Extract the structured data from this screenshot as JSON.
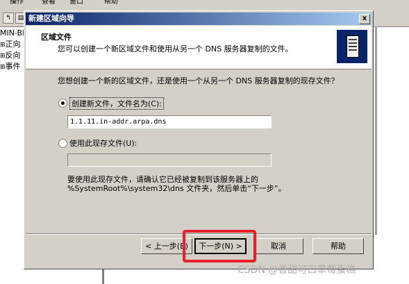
{
  "app": {
    "menu": [
      "操作",
      "查看",
      "窗口",
      "帮助"
    ],
    "tree_items": [
      "MIN-BE",
      "正向",
      "反向",
      "事件"
    ]
  },
  "dialog": {
    "title": "新建区域向导",
    "close_label": "x",
    "header": {
      "title": "区域文件",
      "subtitle": "您可以创建一个新区域文件和使用从另一个 DNS 服务器复制的文件。"
    },
    "question": "您想创建一个新的区域文件，还是使用一个从另一个 DNS 服务器复制的现存文件？",
    "option_new": {
      "label": "创建新文件，文件名为(C):",
      "value": "1.1.11.in-addr.arpa.dns",
      "selected": true
    },
    "option_existing": {
      "label": "使用此现存文件(U):",
      "value": "",
      "selected": false
    },
    "note": "要使用此现存文件，请确认它已经被复制到该服务器上的 %SystemRoot%\\system32\\dns 文件夹，然后单击“下一步”。",
    "buttons": {
      "back": "< 上一步(B)",
      "next": "下一步(N) >",
      "cancel": "取消",
      "help": "帮助"
    }
  },
  "watermark": "CSDN @香甜可口草莓蛋糕",
  "colors": {
    "titlebar_start": "#0a246a",
    "titlebar_end": "#a6caf0",
    "highlight": "#e8202a",
    "dialog_bg": "#d4d0c8"
  }
}
